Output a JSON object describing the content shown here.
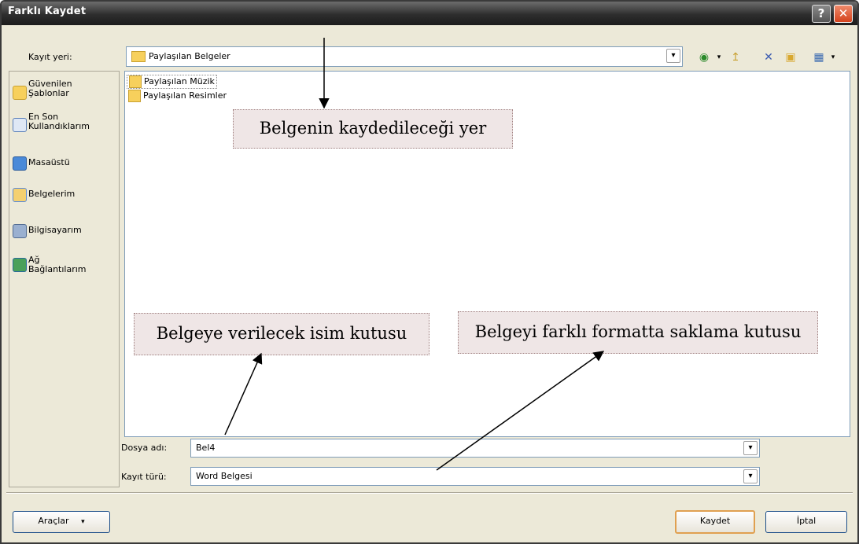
{
  "window": {
    "title": "Farklı Kaydet",
    "help_glyph": "?",
    "close_glyph": "✕"
  },
  "location": {
    "label": "Kayıt yeri:",
    "value": "Paylaşılan Belgeler"
  },
  "toolbar": {
    "back": "◉",
    "up": "↥",
    "delete": "✕",
    "new_folder": "▣",
    "views": "▦"
  },
  "places": [
    {
      "label": "Güvenilen\nŞablonlar",
      "icon": "folder-icon"
    },
    {
      "label": "En Son\nKullandıklarım",
      "icon": "recent-icon"
    },
    {
      "label": "Masaüstü",
      "icon": "desktop-icon"
    },
    {
      "label": "Belgelerim",
      "icon": "documents-icon"
    },
    {
      "label": "Bilgisayarım",
      "icon": "computer-icon"
    },
    {
      "label": "Ağ\nBağlantılarım",
      "icon": "network-icon"
    }
  ],
  "files": [
    {
      "name": "Paylaşılan Müzik"
    },
    {
      "name": "Paylaşılan Resimler"
    }
  ],
  "callouts": {
    "location": "Belgenin kaydedileceği yer",
    "filename": "Belgeye verilecek isim kutusu",
    "filetype": "Belgeyi farklı formatta saklama kutusu"
  },
  "filename": {
    "label": "Dosya adı:",
    "value": "Bel4"
  },
  "filetype": {
    "label": "Kayıt türü:",
    "value": "Word Belgesi"
  },
  "buttons": {
    "tools": "Araçlar",
    "save": "Kaydet",
    "cancel": "İptal"
  },
  "colors": {
    "title_bar": "#2e2e2e",
    "close": "#d4421c",
    "dialog_bg": "#ece9d8",
    "callout_bg": "#efe6e6"
  }
}
